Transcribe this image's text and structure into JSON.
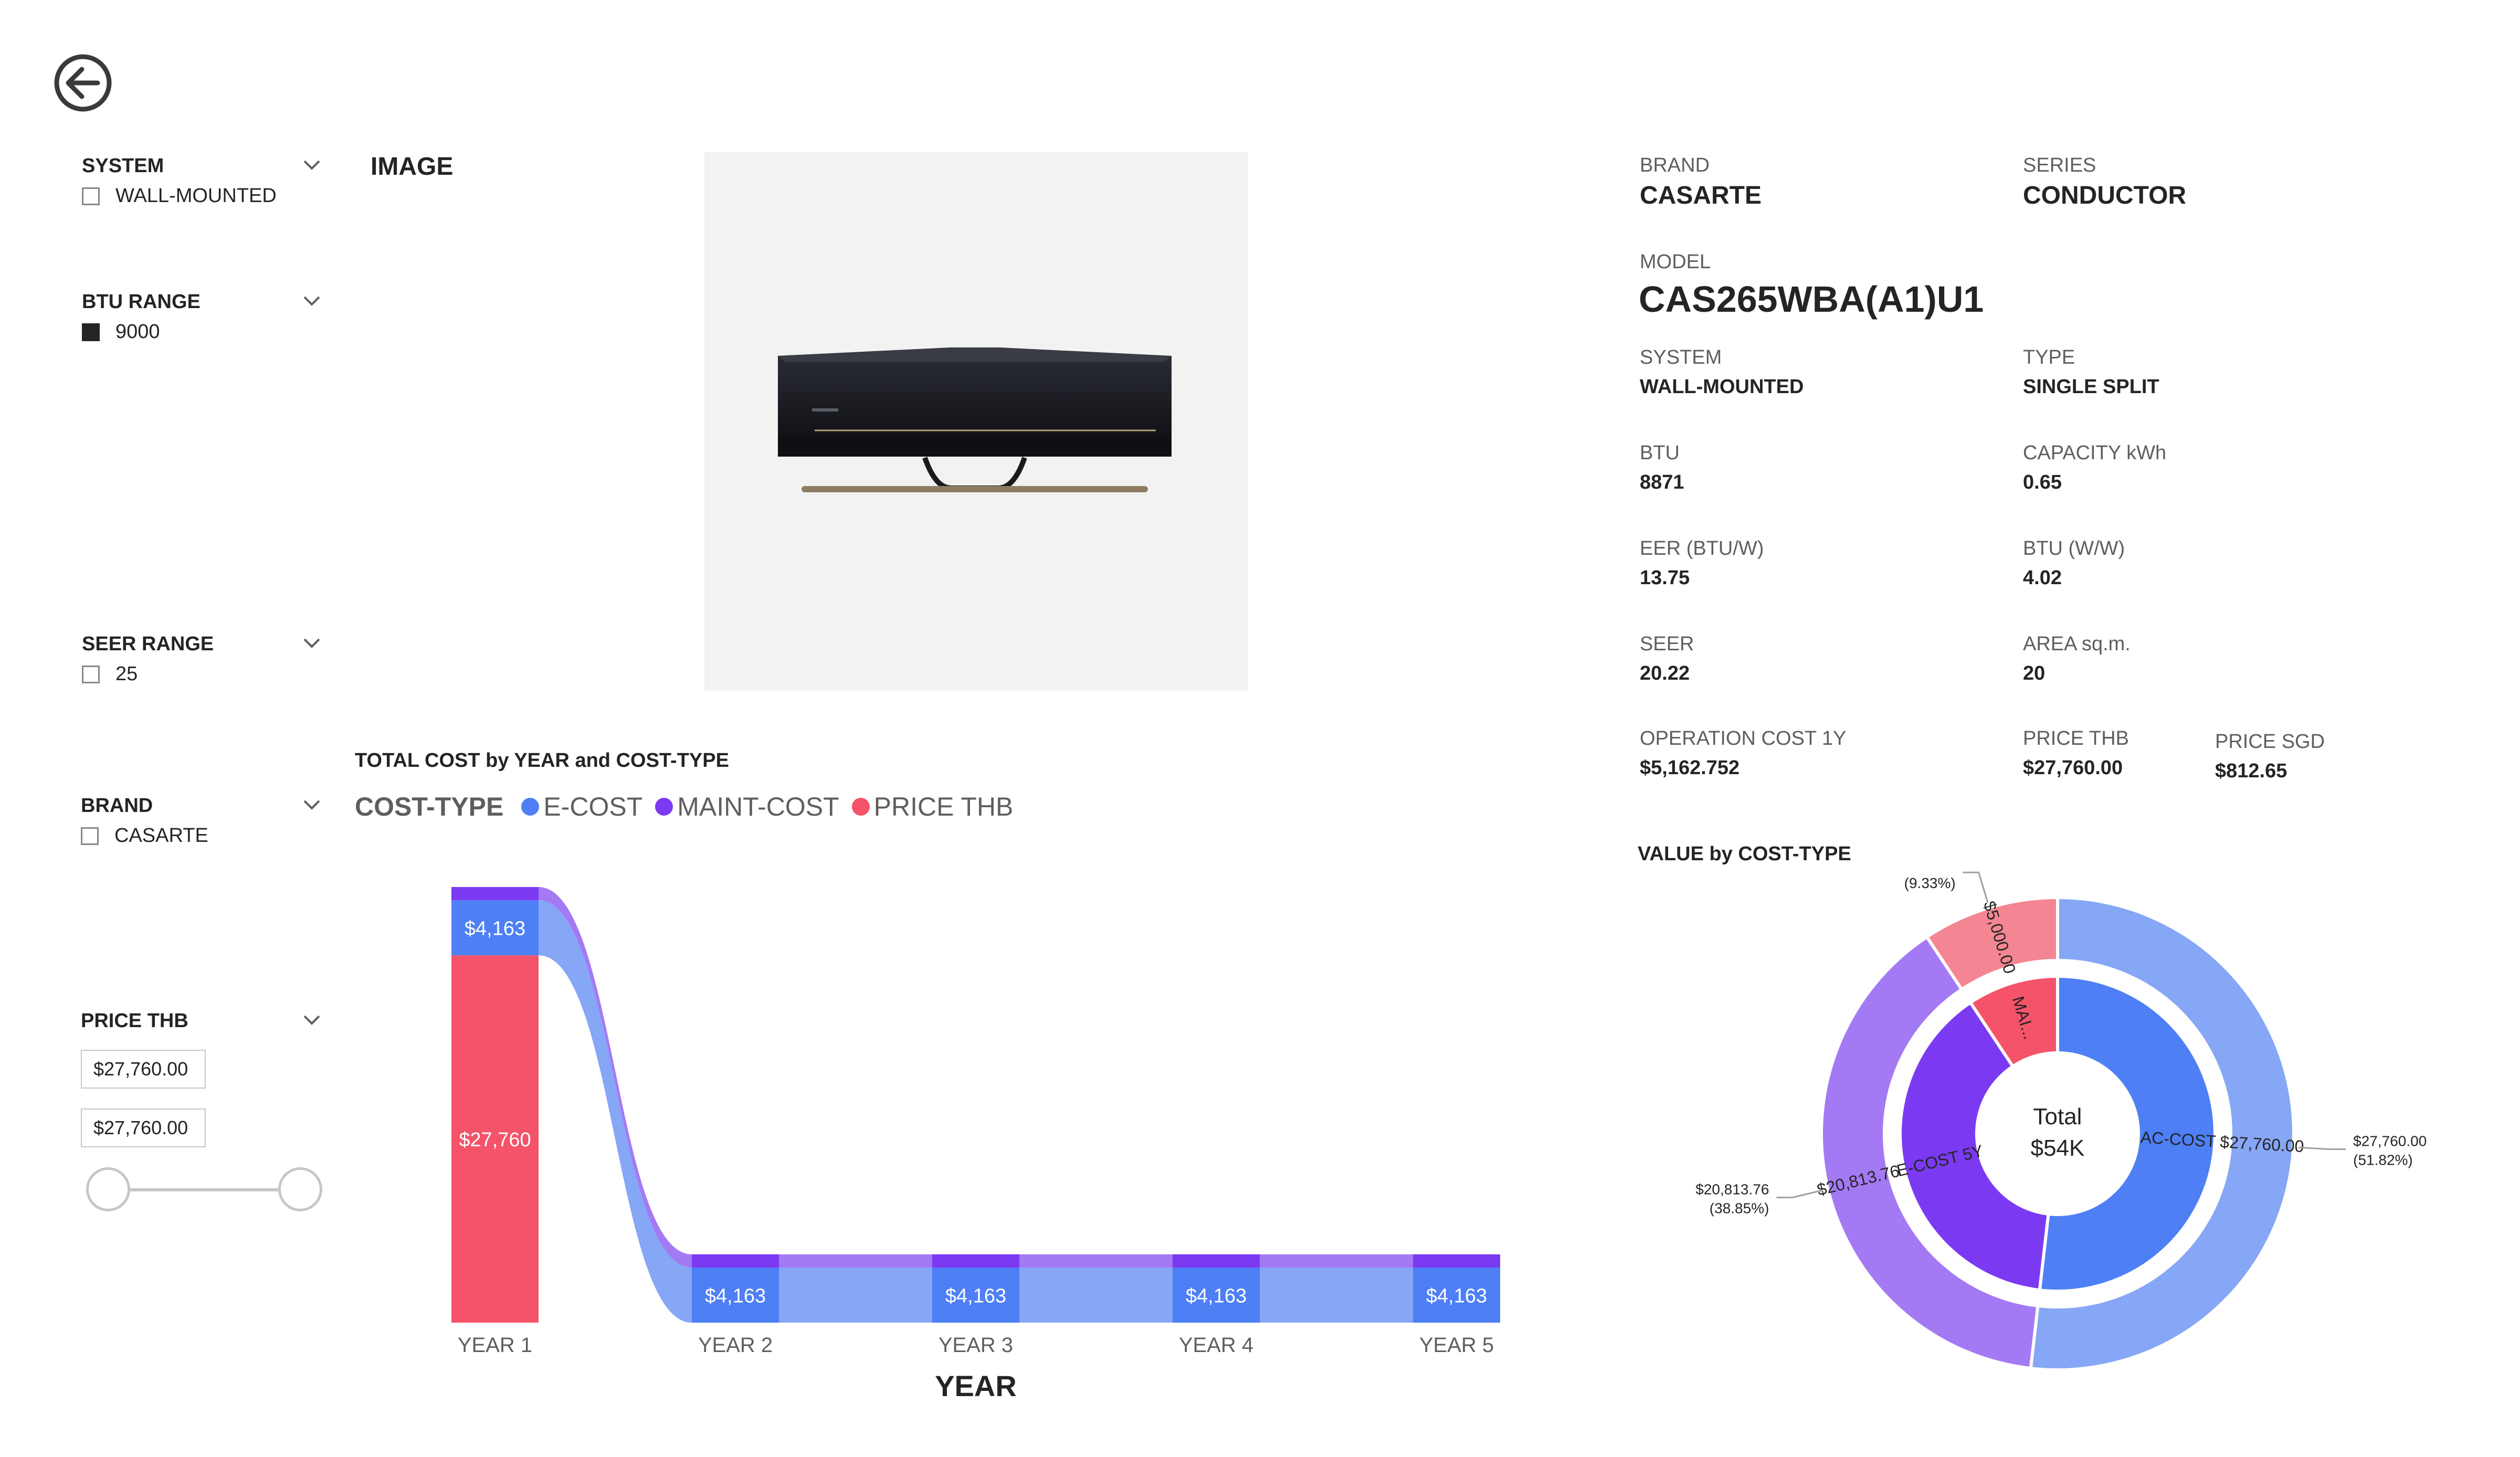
{
  "slicers": {
    "system": {
      "title": "SYSTEM",
      "option": "WALL-MOUNTED",
      "checked": false
    },
    "btu": {
      "title": "BTU RANGE",
      "option": "9000",
      "checked": true
    },
    "seer": {
      "title": "SEER RANGE",
      "option": "25",
      "checked": false
    },
    "brand": {
      "title": "BRAND",
      "option": "CASARTE",
      "checked": false
    },
    "price": {
      "title": "PRICE THB",
      "min": "$27,760.00",
      "max": "$27,760.00"
    }
  },
  "image_section": {
    "title": "IMAGE"
  },
  "details": {
    "brand_label": "BRAND",
    "brand": "CASARTE",
    "series_label": "SERIES",
    "series": "CONDUCTOR",
    "model_label": "MODEL",
    "model": "CAS265WBA(A1)U1",
    "system_label": "SYSTEM",
    "system": "WALL-MOUNTED",
    "type_label": "TYPE",
    "type": "SINGLE SPLIT",
    "btu_label": "BTU",
    "btu": "8871",
    "capacity_label": "CAPACITY kWh",
    "capacity": "0.65",
    "eer_label": "EER (BTU/W)",
    "eer": "13.75",
    "btuw_label": "BTU (W/W)",
    "btuw": "4.02",
    "seer_label": "SEER",
    "seer": "20.22",
    "area_label": "AREA sq.m.",
    "area": "20",
    "opcost_label": "OPERATION COST 1Y",
    "opcost": "$5,162.752",
    "price_thb_label": "PRICE THB",
    "price_thb": "$27,760.00",
    "price_sgd_label": "PRICE SGD",
    "price_sgd": "$812.65"
  },
  "colors": {
    "e_cost": "#4e7ff5",
    "e_cost_light": "#86a6f6",
    "maint": "#7b3af2",
    "maint_light": "#a479f4",
    "price": "#f4536a",
    "price_light": "#f48693"
  },
  "chart_data": [
    {
      "type": "bar",
      "title": "TOTAL COST by YEAR and COST-TYPE",
      "legend_title": "COST-TYPE",
      "legend": [
        "E-COST",
        "MAINT-COST",
        "PRICE THB"
      ],
      "xlabel": "YEAR",
      "categories": [
        "YEAR 1",
        "YEAR 2",
        "YEAR 3",
        "YEAR 4",
        "YEAR 5"
      ],
      "series": [
        {
          "name": "PRICE THB",
          "values": [
            27760,
            0,
            0,
            0,
            0
          ]
        },
        {
          "name": "E-COST",
          "values": [
            4163,
            4163,
            4163,
            4163,
            4163
          ]
        },
        {
          "name": "MAINT-COST",
          "values": [
            1000,
            1000,
            1000,
            1000,
            1000
          ]
        }
      ],
      "data_labels": [
        {
          "category": "YEAR 1",
          "series": "E-COST",
          "text": "$4,163"
        },
        {
          "category": "YEAR 1",
          "series": "PRICE THB",
          "text": "$27,760"
        },
        {
          "category": "YEAR 2",
          "series": "E-COST",
          "text": "$4,163"
        },
        {
          "category": "YEAR 3",
          "series": "E-COST",
          "text": "$4,163"
        },
        {
          "category": "YEAR 4",
          "series": "E-COST",
          "text": "$4,163"
        },
        {
          "category": "YEAR 5",
          "series": "E-COST",
          "text": "$4,163"
        }
      ]
    },
    {
      "type": "pie",
      "title": "VALUE by COST-TYPE",
      "center_label": "Total",
      "center_value": "$54K",
      "outer": [
        {
          "label": "$27,760.00",
          "value": 27760.0,
          "callout": "$27,760.00",
          "percent": "(51.82%)"
        },
        {
          "label": "$20,813.76",
          "value": 20813.76,
          "callout": "$20,813.76",
          "percent": "(38.85%)"
        },
        {
          "label": "$5,000.00",
          "value": 5000.0,
          "callout": "$5,000.00",
          "percent": "(9.33%)"
        }
      ],
      "inner": [
        {
          "label": "AC-COST",
          "value": 27760.0
        },
        {
          "label": "E-COST 5Y",
          "value": 20813.76
        },
        {
          "label": "MAI...",
          "value": 5000.0
        }
      ]
    }
  ]
}
